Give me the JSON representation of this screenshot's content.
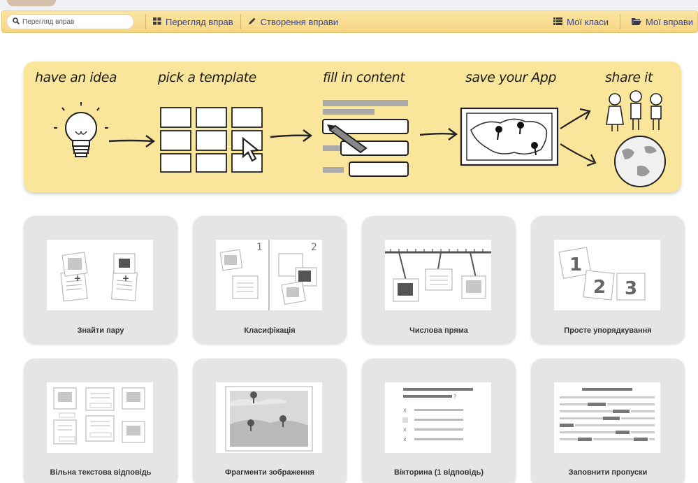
{
  "navbar": {
    "search_placeholder": "Перегляд вправ",
    "items": [
      {
        "label": "Перегляд вправ",
        "icon": "grid-icon"
      },
      {
        "label": "Створення вправи",
        "icon": "pencil-icon"
      },
      {
        "label": "Мої класи",
        "icon": "list-icon"
      },
      {
        "label": "Мої вправи",
        "icon": "folder-icon"
      }
    ]
  },
  "banner": {
    "steps": [
      {
        "label": "have an idea"
      },
      {
        "label": "pick a template"
      },
      {
        "label": "fill in content"
      },
      {
        "label": "save your App"
      },
      {
        "label": "share it"
      }
    ]
  },
  "templates": [
    {
      "title": "Знайти пару"
    },
    {
      "title": "Класифікація"
    },
    {
      "title": "Числова пряма"
    },
    {
      "title": "Просте упорядкування"
    },
    {
      "title": "Вільна текстова відповідь"
    },
    {
      "title": "Фрагменти зображення"
    },
    {
      "title": "Вікторина (1 відповідь)"
    },
    {
      "title": "Заповнити пропуски"
    }
  ],
  "colors": {
    "navbar": "#f8dd8e",
    "nav_link": "#31409a",
    "banner": "#fae69a",
    "card": "#e5e5e5"
  }
}
